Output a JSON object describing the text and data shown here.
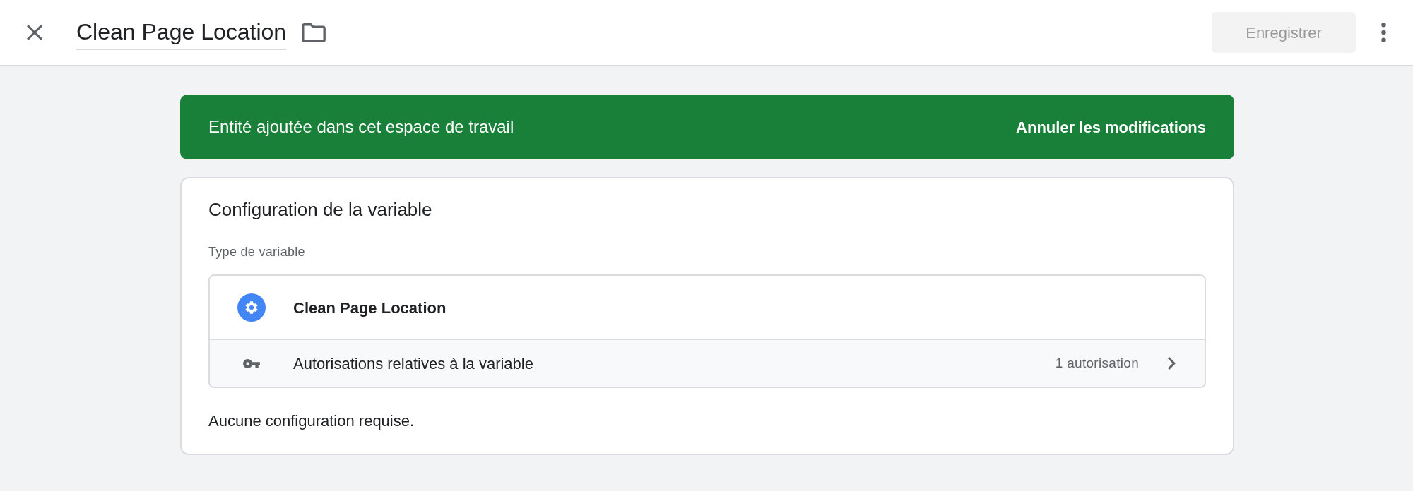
{
  "header": {
    "title": "Clean Page Location",
    "save_button": {
      "label": "Enregistrer",
      "disabled": true
    }
  },
  "banner": {
    "message": "Entité ajoutée dans cet espace de travail",
    "action": "Annuler les modifications"
  },
  "card": {
    "title": "Configuration de la variable",
    "type_label": "Type de variable",
    "type_rows": [
      {
        "kind": "type",
        "label": "Clean Page Location"
      },
      {
        "kind": "permissions",
        "label": "Autorisations relatives à la variable",
        "count": "1 autorisation"
      }
    ],
    "note": "Aucune configuration requise."
  }
}
